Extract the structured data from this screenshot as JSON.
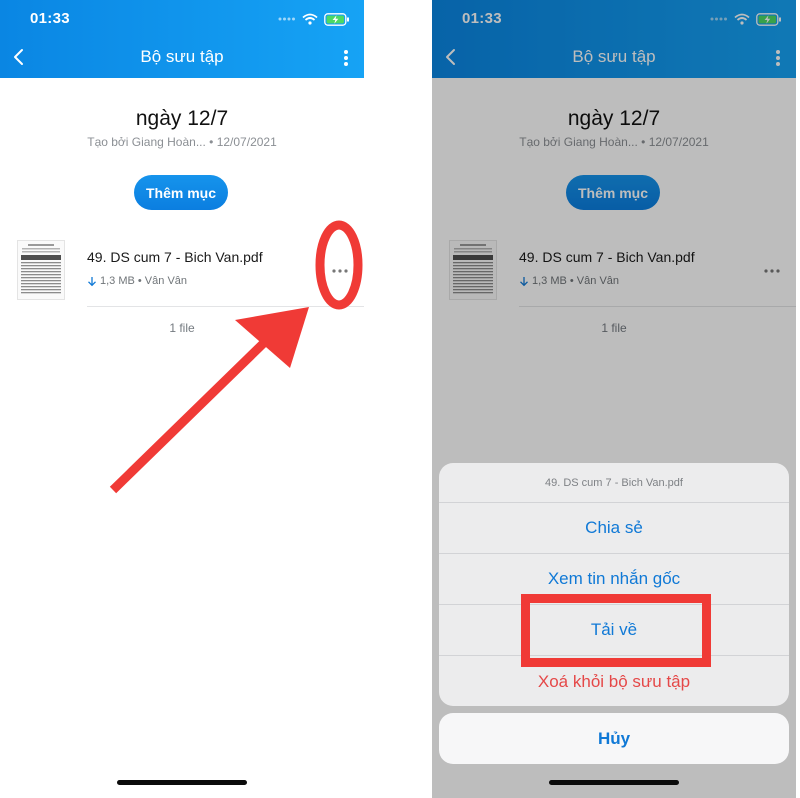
{
  "status_bar": {
    "time": "01:33"
  },
  "header": {
    "title": "Bộ sưu tập"
  },
  "collection": {
    "name": "ngày 12/7",
    "subtitle": "Tạo bởi Giang Hoàn... • 12/07/2021",
    "add_button_label": "Thêm mục"
  },
  "file": {
    "name": "49. DS cum 7 - Bich Van.pdf",
    "meta": "1,3 MB • Vân Vân"
  },
  "file_count": "1 file",
  "action_sheet": {
    "title": "49. DS cum 7 - Bich Van.pdf",
    "items": [
      {
        "label": "Chia sẻ"
      },
      {
        "label": "Xem tin nhắn gốc"
      },
      {
        "label": "Tải về"
      },
      {
        "label": "Xoá khỏi bộ sưu tập"
      }
    ],
    "cancel_label": "Hủy"
  },
  "colors": {
    "header_gradient_start": "#0a86e3",
    "header_gradient_end": "#16a3f5",
    "action_blue": "#1079d6",
    "destructive_red": "#e54848",
    "annotation_red": "#f03a36"
  },
  "icons": [
    "back-icon",
    "more-vertical-icon",
    "wifi-icon",
    "battery-charging-icon",
    "signal-icon",
    "download-arrow-icon",
    "more-horizontal-icon",
    "pdf-thumbnail"
  ]
}
